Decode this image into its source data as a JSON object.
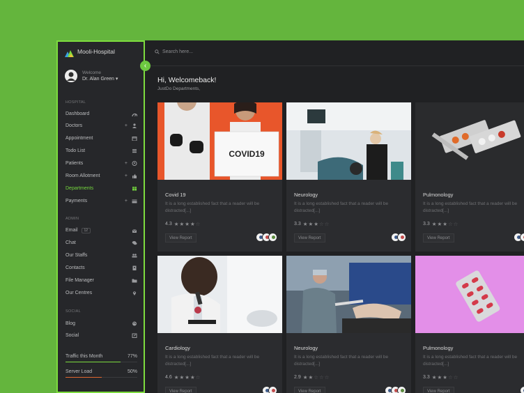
{
  "brand": {
    "name": "Mooli-Hospital"
  },
  "user": {
    "welcome": "Welcome",
    "name": "Dr. Alan Green ▾"
  },
  "search": {
    "placeholder": "Search here..."
  },
  "greeting": {
    "title": "Hi, Welcomeback!",
    "subtitle": "JustDo Departments,"
  },
  "sections": {
    "hospital": "HOSPITAL",
    "admin": "ADMIN",
    "social": "SOCIAL"
  },
  "nav": {
    "hospital": [
      {
        "label": "Dashboard",
        "icon": "gauge-icon",
        "plus": ""
      },
      {
        "label": "Doctors",
        "icon": "user-md-icon",
        "plus": "+"
      },
      {
        "label": "Appointment",
        "icon": "calendar-icon",
        "plus": ""
      },
      {
        "label": "Todo List",
        "icon": "list-icon",
        "plus": ""
      },
      {
        "label": "Patients",
        "icon": "user-circle-icon",
        "plus": "+"
      },
      {
        "label": "Room Allotment",
        "icon": "thumbs-up-icon",
        "plus": "+"
      },
      {
        "label": "Departments",
        "icon": "table-icon",
        "plus": ""
      },
      {
        "label": "Payments",
        "icon": "credit-card-icon",
        "plus": "+"
      }
    ],
    "admin": [
      {
        "label": "Email",
        "icon": "envelope-icon",
        "badge": "12"
      },
      {
        "label": "Chat",
        "icon": "comments-icon"
      },
      {
        "label": "Our Staffs",
        "icon": "users-icon"
      },
      {
        "label": "Contacts",
        "icon": "address-book-icon"
      },
      {
        "label": "File Manager",
        "icon": "folder-icon"
      },
      {
        "label": "Our Centres",
        "icon": "map-marker-icon"
      }
    ],
    "social": [
      {
        "label": "Blog",
        "icon": "globe-icon"
      },
      {
        "label": "Social",
        "icon": "share-icon"
      }
    ]
  },
  "stats": [
    {
      "label": "Traffic this Month",
      "value": "77%",
      "fraction": 0.77,
      "color": "#7ddc3e"
    },
    {
      "label": "Server Load",
      "value": "50%",
      "fraction": 0.5,
      "color": "#e0662f"
    }
  ],
  "cards": [
    {
      "title": "Covid 19",
      "desc": "It is a long established fact that a reader will be distracted[...]",
      "rating": "4.3",
      "stars": 4,
      "button": "View Report",
      "avatars": 3,
      "image": "covid-sign-photo"
    },
    {
      "title": "Neurology",
      "desc": "It is a long established fact that a reader will be distracted[...]",
      "rating": "3.3",
      "stars": 3,
      "button": "View Report",
      "avatars": 2,
      "image": "dental-clinic-photo"
    },
    {
      "title": "Pulmonology",
      "desc": "It is a long established fact that a reader will be distracted[...]",
      "rating": "3.3",
      "stars": 3,
      "button": "View Report",
      "avatars": 3,
      "image": "pills-photo"
    },
    {
      "title": "Cardiology",
      "desc": "It is a long established fact that a reader will be distracted[...]",
      "rating": "4.6",
      "stars": 4,
      "button": "View Report",
      "avatars": 2,
      "image": "microscope-photo"
    },
    {
      "title": "Neurology",
      "desc": "It is a long established fact that a reader will be distracted[...]",
      "rating": "2.9",
      "stars": 2,
      "button": "View Report",
      "avatars": 3,
      "image": "surgery-photo"
    },
    {
      "title": "Pulmonology",
      "desc": "It is a long established fact that a reader will be distracted[...]",
      "rating": "3.3",
      "stars": 3,
      "button": "View Report",
      "avatars": 2,
      "image": "pill-pack-photo"
    }
  ],
  "colors": {
    "accent": "#7ddc3e",
    "background": "#64b53d",
    "panel": "#202123",
    "card": "#2b2c2f"
  }
}
